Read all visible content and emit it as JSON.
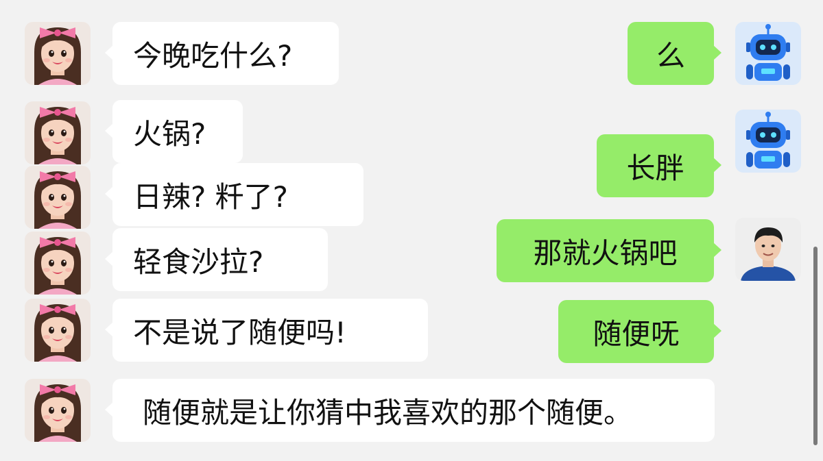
{
  "chat": {
    "messages": [
      {
        "sender": "girl",
        "side": "left",
        "text": "今晚吃什么?"
      },
      {
        "sender": "robot",
        "side": "right",
        "text": "么"
      },
      {
        "sender": "girl",
        "side": "left",
        "text": "火锅?"
      },
      {
        "sender": "robot",
        "side": "right",
        "text": "长胖"
      },
      {
        "sender": "girl",
        "side": "left",
        "text": "日辣? 粁了?"
      },
      {
        "sender": "man",
        "side": "right",
        "text": "那就火锅吧"
      },
      {
        "sender": "girl",
        "side": "left",
        "text": "轻食沙拉?"
      },
      {
        "sender": "girl",
        "side": "left",
        "text": "不是说了随便吗!"
      },
      {
        "sender": "man",
        "side": "right",
        "text": "随便呒"
      },
      {
        "sender": "girl",
        "side": "left",
        "text": "随便就是让你猜中我喜欢的那个随便。"
      }
    ]
  },
  "colors": {
    "background": "#f2f2f2",
    "left_bubble": "#ffffff",
    "right_bubble": "#95ec69",
    "robot_blue": "#2f7df0",
    "bow_pink": "#f27aa8"
  },
  "icons": {
    "girl_avatar": "girl-with-pink-bow-avatar",
    "robot_avatar": "blue-robot-avatar",
    "man_avatar": "man-avatar"
  }
}
